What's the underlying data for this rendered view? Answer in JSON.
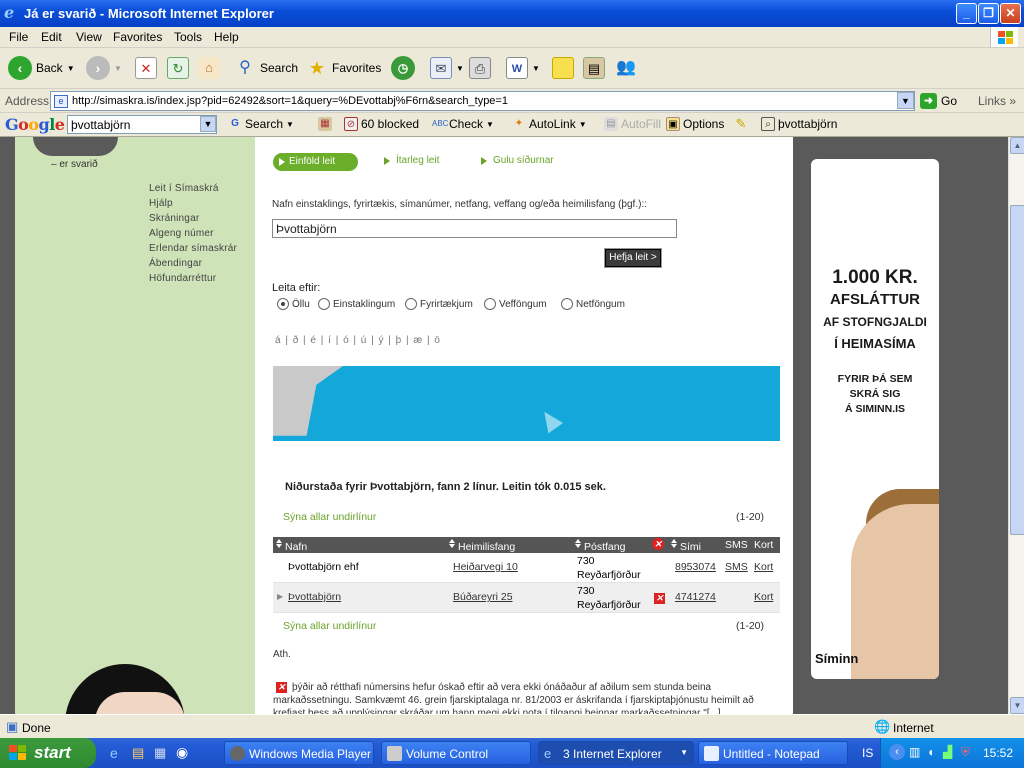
{
  "window": {
    "title": "Já er svarið - Microsoft Internet Explorer"
  },
  "menu": [
    "File",
    "Edit",
    "View",
    "Favorites",
    "Tools",
    "Help"
  ],
  "toolbar": {
    "back": "Back",
    "search": "Search",
    "favorites": "Favorites"
  },
  "address": {
    "label": "Address",
    "url": "http://simaskra.is/index.jsp?pid=62492&sort=1&query=%DEvottabj%F6rn&search_type=1",
    "go": "Go",
    "links": "Links"
  },
  "googlebar": {
    "logo": "Google",
    "query": "þvottabjörn",
    "search": "Search",
    "blocked": "60 blocked",
    "check": "Check",
    "autolink": "AutoLink",
    "autofill": "AutoFill",
    "options": "Options",
    "term": "þvottabjörn"
  },
  "page": {
    "tagline": "– er svarið",
    "nav": [
      "Leit í Símaskrá",
      "Hjálp",
      "Skráningar",
      "Algeng númer",
      "Erlendar símaskrár",
      "Ábendingar",
      "Höfundarréttur"
    ],
    "tabs": {
      "simple": "Einföld leit",
      "detailed": "Ítarleg leit",
      "yellow": "Gulu síðurnar"
    },
    "search_label": "Nafn einstaklings, fyrirtækis, símanúmer, netfang, veffang og/eða heimilisfang (þgf.)::",
    "search_value": "Þvottabjörn",
    "search_button": "Hefja leit >",
    "filter_label": "Leita eftir:",
    "filters": [
      "Öllu",
      "Einstaklingum",
      "Fyrirtækjum",
      "Vefföngum",
      "Netföngum"
    ],
    "chars": "á | ð | é | í | ó | ú | ý | þ | æ | ö",
    "result_title": "Niðurstaða fyrir Þvottabjörn, fann 2 línur. Leitin tók 0.015 sek.",
    "show_all": "Sýna allar undirlínur",
    "range": "(1-20)",
    "columns": {
      "name": "Nafn",
      "address": "Heimilisfang (þgf.)",
      "postal": "Póstfang",
      "phone": "Sími",
      "sms": "SMS",
      "map": "Kort"
    },
    "rows": [
      {
        "name": "Þvottabjörn ehf",
        "address": "Heiðarvegi 10",
        "zip": "730",
        "town": "Reyðarfjörður",
        "phone": "8953074",
        "sms": "SMS",
        "map": "Kort"
      },
      {
        "name": "Þvottabjörn",
        "address": "Búðareyri 25",
        "zip": "730",
        "town": "Reyðarfjörður",
        "phone": "4741274",
        "sms": "",
        "map": "Kort"
      }
    ],
    "ath": "Ath.",
    "note": "þýðir að rétthafi númersins hefur óskað eftir að vera ekki ónáðaður af aðilum sem stunda beina markaðssetningu. Samkvæmt 46. grein fjarskiptalaga nr. 81/2003 er áskrifanda í fjarskiptaþjónustu heimilt að krefjast þess að upplýsingar skráðar um hann megi ekki nota í tilgangi beinnar markaðssetningar \"[...]"
  },
  "ad": {
    "headline": [
      "1.000 KR.",
      "AFSLÁTTUR",
      "AF STOFNGJALDI",
      "Í HEIMASÍMA"
    ],
    "sub": [
      "FYRIR ÞÁ SEM",
      "SKRÁ SIG",
      "Á SIMINN.IS"
    ],
    "brand": "Síminn"
  },
  "status": {
    "text": "Done",
    "zone": "Internet"
  },
  "taskbar": {
    "start": "start",
    "tasks": [
      "Windows Media Player",
      "Volume Control",
      "3 Internet Explorer",
      "Untitled - Notepad"
    ],
    "lang": "IS",
    "time": "15:52"
  },
  "colors": {
    "accent_green": "#6aae2a",
    "sidebar_green": "#cfe3b8",
    "banner_blue": "#13a7da",
    "taskbar_blue": "#245dd7"
  }
}
